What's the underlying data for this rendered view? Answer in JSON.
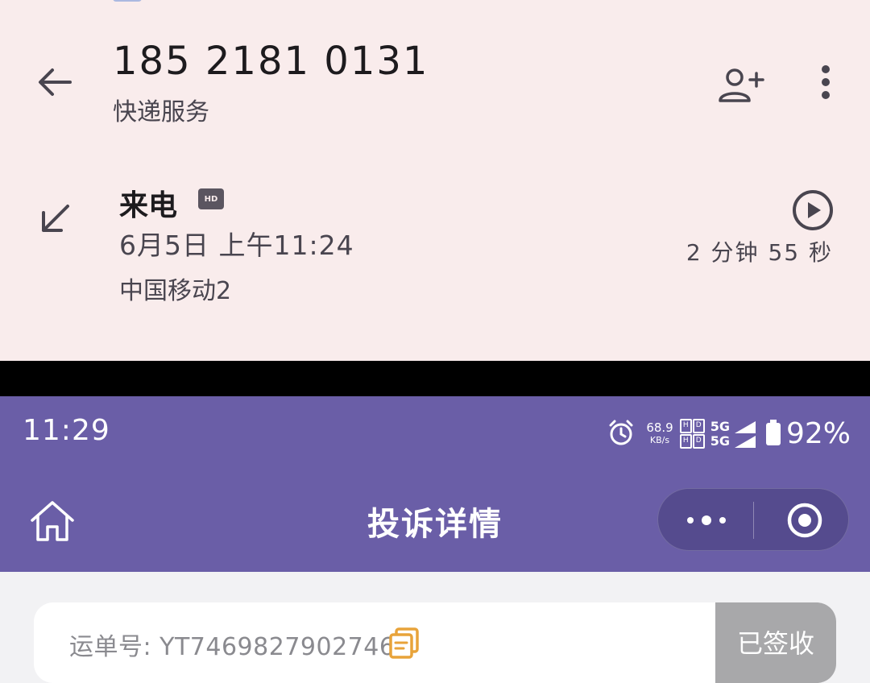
{
  "call_log": {
    "phone_number": "185 2181 0131",
    "contact_label": "快递服务",
    "call_type": "来电",
    "hd_badge": "HD",
    "date_time": "6月5日 上午11:24",
    "carrier": "中国移动2",
    "duration": "2 分钟 55 秒"
  },
  "status_bar": {
    "time": "11:29",
    "net_speed_value": "68.9",
    "net_speed_unit": "KB/s",
    "sim_letters": [
      "H",
      "D",
      "H",
      "D"
    ],
    "net_type_1": "5G",
    "net_type_2": "5G",
    "battery": "92%"
  },
  "mini_program": {
    "title": "投诉详情"
  },
  "complaint_card": {
    "waybill_text": "运单号: YT7469827902746",
    "status_badge": "已签收"
  },
  "colors": {
    "header_purple": "#6a5ea7",
    "call_bg": "#f9ecec",
    "copy_icon": "#e8a33a"
  }
}
